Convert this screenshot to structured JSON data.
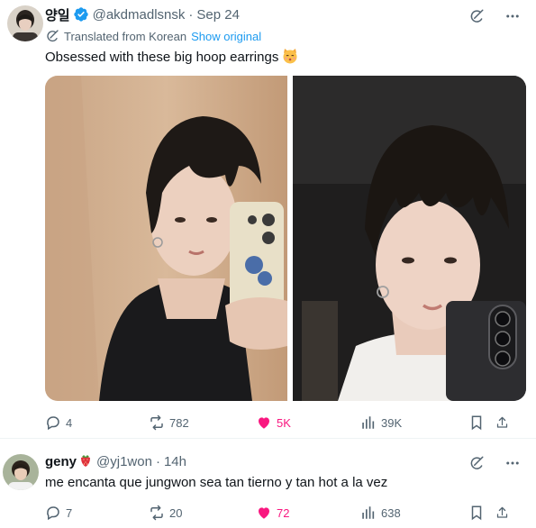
{
  "tweet1": {
    "display_name": "양일",
    "handle": "@akdmadlsnsk",
    "separator": "·",
    "time": "Sep 24",
    "translated_label": "Translated from Korean",
    "show_original": "Show original",
    "text": "Obsessed with these big hoop earrings",
    "stats": {
      "replies": "4",
      "reposts": "782",
      "likes": "5K",
      "views": "39K"
    }
  },
  "tweet2": {
    "display_name": "geny",
    "handle": "@yj1won",
    "separator": "·",
    "time": "14h",
    "text": "me encanta que jungwon sea tan tierno y tan hot a la vez",
    "stats": {
      "replies": "7",
      "reposts": "20",
      "likes": "72",
      "views": "638"
    }
  },
  "colors": {
    "accent": "#1d9bf0",
    "like": "#f91880",
    "secondary_text": "#536471",
    "primary_text": "#0f1419"
  },
  "icons": [
    "verified-badge-icon",
    "grok-icon",
    "more-icon",
    "translate-icon",
    "reply-icon",
    "repost-icon",
    "like-icon",
    "views-icon",
    "bookmark-icon",
    "share-icon",
    "kissing-cat-emoji",
    "strawberry-emoji"
  ]
}
